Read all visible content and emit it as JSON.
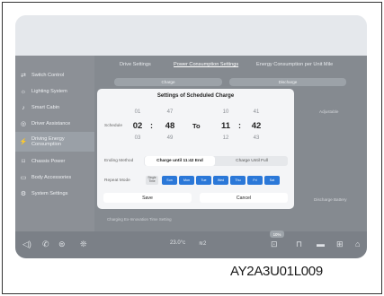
{
  "sidebar": {
    "items": [
      {
        "icon": "switch-icon",
        "glyph": "⇄",
        "label": "Switch Control"
      },
      {
        "icon": "lightbulb-icon",
        "glyph": "☼",
        "label": "Lighting System"
      },
      {
        "icon": "seat-icon",
        "glyph": "♪",
        "label": "Smart Cabin"
      },
      {
        "icon": "steering-wheel-icon",
        "glyph": "◎",
        "label": "Driver Assistance"
      },
      {
        "icon": "energy-icon",
        "glyph": "⚡",
        "label": "Driving Energy Consumption"
      },
      {
        "icon": "chassis-icon",
        "glyph": "⌑",
        "label": "Chassis Power"
      },
      {
        "icon": "accessories-icon",
        "glyph": "▭",
        "label": "Body Accessories"
      },
      {
        "icon": "gear-icon",
        "glyph": "⚙",
        "label": "System Settings"
      }
    ]
  },
  "main": {
    "tabs": [
      "Drive Settings",
      "Power Consumption Settings",
      "Energy Consumption per Unit Mile"
    ],
    "pills": [
      "Charge",
      "Discharge"
    ],
    "side_note": "Adjustable",
    "battery_note": "Discharge Battery",
    "bottom_note": "Charging Ex-Innovation Time Setting"
  },
  "dialog": {
    "title": "Settings of Scheduled Charge",
    "schedule_label": "Schedule",
    "start": {
      "hour_prev": "01",
      "hour": "02",
      "hour_next": "03",
      "min_prev": "47",
      "min": "48",
      "min_next": "49"
    },
    "to_label": "To",
    "end": {
      "hour_prev": "10",
      "hour": "11",
      "hour_next": "12",
      "min_prev": "41",
      "min": "42",
      "min_next": "43"
    },
    "colon": ":",
    "ending_method_label": "Ending Method",
    "ending_options": [
      "Charge until 11:42 End",
      "Charge Until Full"
    ],
    "repeat_label": "Repeat Mode",
    "single_label": "Single Time",
    "days": [
      "Sun",
      "Mon",
      "Tue",
      "Wed",
      "Thu",
      "Fri",
      "Sat"
    ],
    "save_label": "Save",
    "cancel_label": "Cancel"
  },
  "bottombar": {
    "temp_left": "23.0°c",
    "fan_label": "2",
    "badge": "10%"
  },
  "caption": "AY2A3U01L009",
  "colors": {
    "accent": "#2b78d8",
    "dialog_bg": "#f4f5f7",
    "overlay": "#858a90"
  }
}
